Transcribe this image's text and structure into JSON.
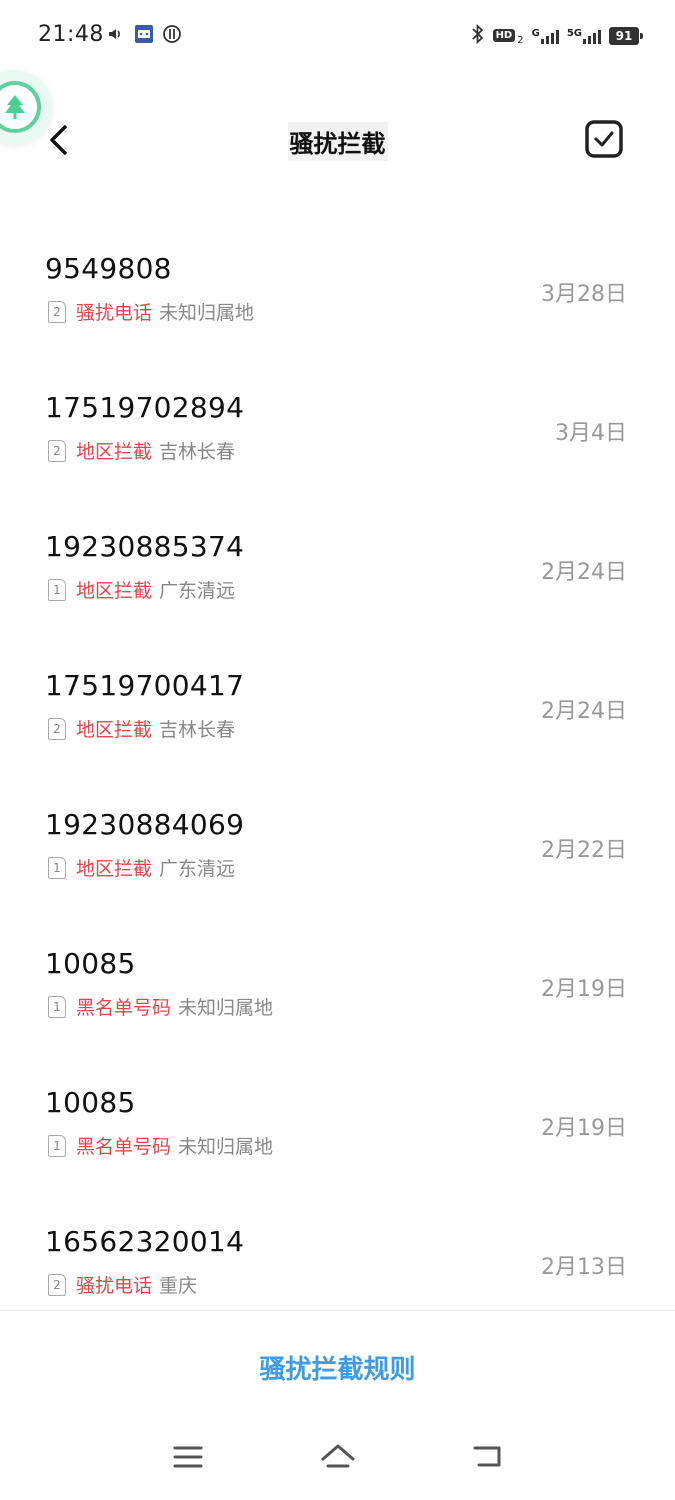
{
  "status_bar": {
    "time": "21:48",
    "battery": "91",
    "hd_label": "HD",
    "hd_sub": "2",
    "net_g": "G",
    "net_5g": "5G",
    "icons": [
      "volume-icon",
      "app-notification-icon",
      "sync-icon",
      "bluetooth-icon",
      "signal-icon",
      "battery-icon"
    ]
  },
  "header": {
    "title": "骚扰拦截"
  },
  "blocked_calls": [
    {
      "number": "9549808",
      "sim": "2",
      "type": "骚扰电话",
      "location": "未知归属地",
      "date": "3月28日"
    },
    {
      "number": "17519702894",
      "sim": "2",
      "type": "地区拦截",
      "location": "吉林长春",
      "date": "3月4日"
    },
    {
      "number": "19230885374",
      "sim": "1",
      "type": "地区拦截",
      "location": "广东清远",
      "date": "2月24日"
    },
    {
      "number": "17519700417",
      "sim": "2",
      "type": "地区拦截",
      "location": "吉林长春",
      "date": "2月24日"
    },
    {
      "number": "19230884069",
      "sim": "1",
      "type": "地区拦截",
      "location": "广东清远",
      "date": "2月22日"
    },
    {
      "number": "10085",
      "sim": "1",
      "type": "黑名单号码",
      "location": "未知归属地",
      "date": "2月19日"
    },
    {
      "number": "10085",
      "sim": "1",
      "type": "黑名单号码",
      "location": "未知归属地",
      "date": "2月19日"
    },
    {
      "number": "16562320014",
      "sim": "2",
      "type": "骚扰电话",
      "location": "重庆",
      "date": "2月13日"
    }
  ],
  "footer": {
    "rule_button": "骚扰拦截规则"
  },
  "colors": {
    "accent_blue": "#3f9be6",
    "tag_red": "#e0474c",
    "muted_gray": "#999999",
    "bubble_green": "#5fd0a0"
  }
}
